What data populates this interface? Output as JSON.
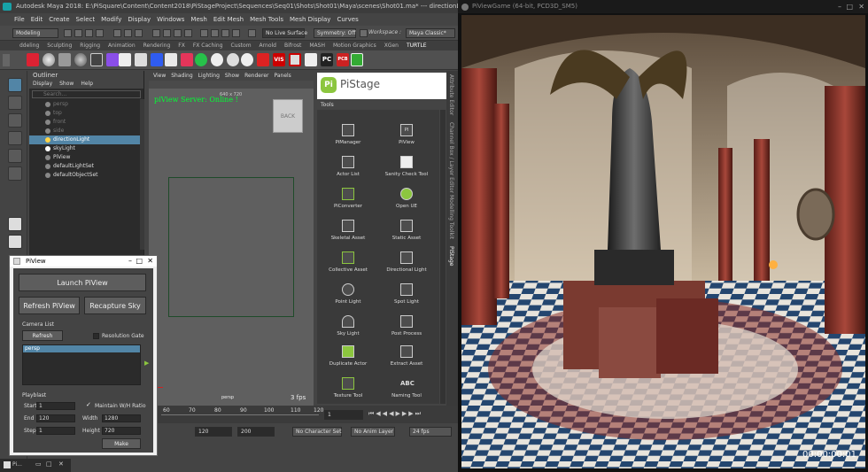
{
  "maya": {
    "title": "Autodesk Maya 2018: E:\\PiSquare\\Content\\Content2018\\PiStageProject\\Sequences\\Seq01\\Shots\\Shot01\\Maya\\scenes\\Shot01.ma*  ---  directionLight",
    "menus": [
      "File",
      "Edit",
      "Create",
      "Select",
      "Modify",
      "Display",
      "Windows",
      "Mesh",
      "Edit Mesh",
      "Mesh Tools",
      "Mesh Display",
      "Curves"
    ],
    "mode": "Modeling",
    "live_surface": "No Live Surface",
    "symmetry": "Symmetry: Off",
    "workspace_label": "Workspace :",
    "workspace": "Maya Classic*",
    "shelf_tabs": [
      "ddeling",
      "Sculpting",
      "Rigging",
      "Animation",
      "Rendering",
      "FX",
      "FX Caching",
      "Custom",
      "Arnold",
      "Bifrost",
      "MASH",
      "Motion Graphics",
      "XGen",
      "TURTLE"
    ],
    "shelf_labels": {
      "vis": "VIS",
      "pc": "PC",
      "pcb": "PCB"
    }
  },
  "outliner": {
    "title": "Outliner",
    "menus": [
      "Display",
      "Show",
      "Help"
    ],
    "search_placeholder": "Search...",
    "items": [
      "persp",
      "top",
      "front",
      "side",
      "directionLight",
      "skyLight",
      "PiView",
      "defaultLightSet",
      "defaultObjectSet"
    ]
  },
  "viewport": {
    "menus": [
      "View",
      "Shading",
      "Lighting",
      "Show",
      "Renderer",
      "Panels"
    ],
    "server_status": "piView Server: Online !",
    "resolution": "640 x 720",
    "cube_label": "BACK",
    "camera": "persp",
    "fps": "3 fps"
  },
  "pistage": {
    "logo": "Pi",
    "title": "PiStage",
    "tab": "Tools",
    "tools": [
      "PiManager",
      "PiView",
      "Actor List",
      "Sanity Check Tool",
      "PiConverter",
      "Open UE",
      "Skeletal Asset",
      "Static Asset",
      "Collective Asset",
      "Directional Light",
      "Point Light",
      "Spot Light",
      "Sky Light",
      "Post Process",
      "Duplicate Actor",
      "Extract Asset",
      "Texture Tool",
      "Naming Tool"
    ],
    "piview_icon": "PI",
    "abc_icon": "ABC"
  },
  "side_tabs": [
    "Attribute Editor",
    "Channel Box / Layer Editor",
    "Modelling Toolkit",
    "PiStage"
  ],
  "timeline": {
    "ticks": [
      "60",
      "70",
      "80",
      "90",
      "100",
      "110",
      "120"
    ],
    "current_frame": "1",
    "range_end": "120",
    "range_max": "200",
    "character_set": "No Character Set",
    "anim_layer": "No Anim Layer",
    "fps": "24 fps"
  },
  "piview_window": {
    "title": "PiView",
    "launch": "Launch PiView",
    "refresh": "Refresh PiView",
    "recapture": "Recapture Sky",
    "camera_list_label": "Camera List",
    "refresh_small": "Refresh",
    "resolution_gate": "Resolution Gate",
    "camera_selected": "persp",
    "playblast_label": "Playblast",
    "start_label": "Start",
    "start": "1",
    "end_label": "End",
    "end": "120",
    "step_label": "Step",
    "step": "1",
    "maintain_ratio": "Maintain W/H Ratio",
    "width_label": "Width",
    "width": "1280",
    "height_label": "Height",
    "height": "720",
    "make": "Make"
  },
  "taskbar": {
    "label": "Pi..."
  },
  "game": {
    "title": "PiViewGame (64-bit, PCD3D_SM5)",
    "timecode": "00:00:00:01"
  },
  "colors": {
    "accent": "#5285a6",
    "pistage_green": "#8cc63f",
    "server_green": "#00ff33"
  }
}
